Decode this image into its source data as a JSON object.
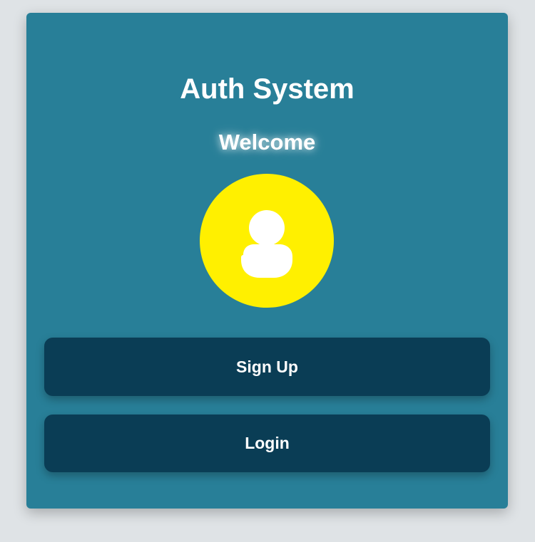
{
  "card": {
    "title": "Auth System",
    "subtitle": "Welcome",
    "avatar_icon": "user-icon",
    "colors": {
      "card_background": "#287f98",
      "page_background": "#dfe3e6",
      "avatar_background": "#fff000",
      "button_background": "#0a3d55",
      "text": "#ffffff"
    }
  },
  "actions": {
    "signup_label": "Sign Up",
    "login_label": "Login"
  }
}
